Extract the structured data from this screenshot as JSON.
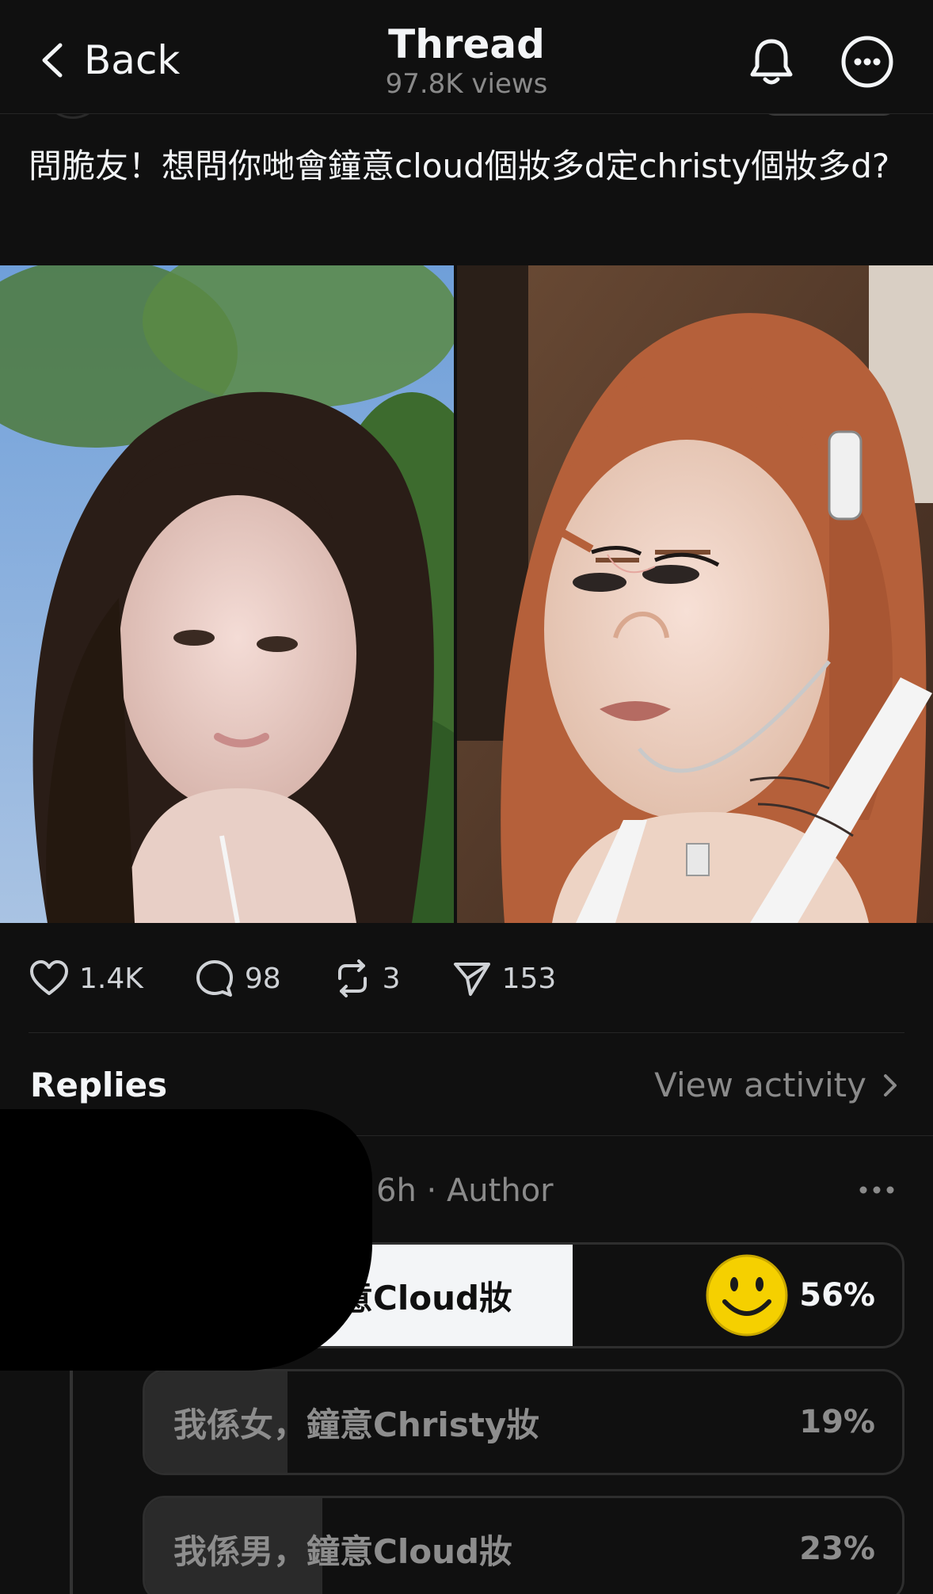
{
  "header": {
    "back_label": "Back",
    "title": "Thread",
    "views": "97.8K views"
  },
  "post": {
    "text": "問脆友！想問你哋會鐘意cloud個妝多d定christy個妝多d?",
    "images": [
      {
        "description_icon": "photo-left"
      },
      {
        "description_icon": "photo-right"
      }
    ],
    "actions": {
      "likes": "1.4K",
      "comments": "98",
      "reposts": "3",
      "shares": "153"
    }
  },
  "replies": {
    "label": "Replies",
    "view_activity": "View activity"
  },
  "reply": {
    "meta": "6h · Author",
    "poll": [
      {
        "label": "我係女，鐘意Cloud妝",
        "percent": "56%",
        "value": 0.56,
        "selected": true
      },
      {
        "label": "我係女，鐘意Christy妝",
        "percent": "19%",
        "value": 0.19,
        "selected": false
      },
      {
        "label": "我係男，鐘意Cloud妝",
        "percent": "23%",
        "value": 0.23,
        "selected": false
      }
    ]
  },
  "colors": {
    "background": "#101010",
    "text": "#f3f5f7",
    "muted": "#8a8a8a",
    "poll_selected_fill": "#f3f5f7"
  }
}
